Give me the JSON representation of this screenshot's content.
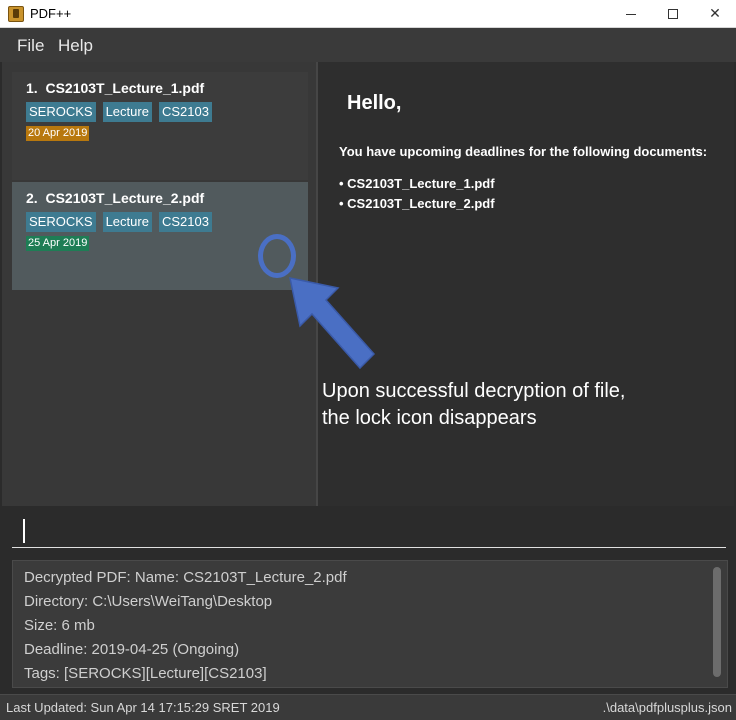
{
  "window": {
    "title": "PDF++",
    "icon": "pdf-app-icon",
    "minimize": "minimize",
    "maximize": "maximize",
    "close": "close"
  },
  "menu": {
    "file": "File",
    "help": "Help"
  },
  "documents": [
    {
      "index": "1.",
      "name": "CS2103T_Lecture_1.pdf",
      "tags": [
        "SEROCKS",
        "Lecture",
        "CS2103"
      ],
      "deadline": "20 Apr 2019",
      "deadline_color": "#b8780e"
    },
    {
      "index": "2.",
      "name": "CS2103T_Lecture_2.pdf",
      "tags": [
        "SEROCKS",
        "Lecture",
        "CS2103"
      ],
      "deadline": "25 Apr 2019",
      "deadline_color": "#1e7d55"
    }
  ],
  "browser": {
    "greeting": "Hello,",
    "intro": "You have upcoming deadlines for the following documents:",
    "items": [
      "CS2103T_Lecture_1.pdf",
      "CS2103T_Lecture_2.pdf"
    ]
  },
  "annotation": {
    "line1": "Upon successful decryption of file,",
    "line2": "the lock icon disappears",
    "color": "#4a6fc4"
  },
  "command": {
    "value": "",
    "placeholder": ""
  },
  "result": {
    "lines": [
      "Decrypted PDF: Name: CS2103T_Lecture_2.pdf",
      "Directory: C:\\Users\\WeiTang\\Desktop",
      "Size: 6 mb",
      "Deadline: 2019-04-25 (Ongoing)",
      "Tags: [SEROCKS][Lecture][CS2103]"
    ]
  },
  "status": {
    "last_updated": "Last Updated: Sun Apr 14 17:15:29 SRET 2019",
    "path": ".\\data\\pdfplusplus.json"
  }
}
